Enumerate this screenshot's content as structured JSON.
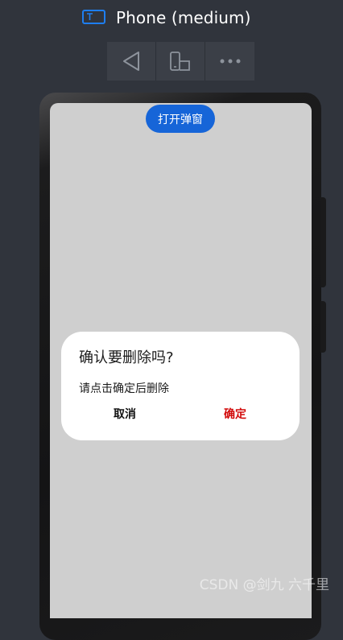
{
  "header": {
    "icon": "text-device-icon",
    "title": "Phone (medium)"
  },
  "toolbar": {
    "items": [
      {
        "icon": "back-triangle-icon"
      },
      {
        "icon": "device-rotate-icon"
      },
      {
        "icon": "more-dots-icon"
      }
    ]
  },
  "screen": {
    "open_button_label": "打开弹窗",
    "background_color": "#cfcfcf"
  },
  "dialog": {
    "title": "确认要删除吗?",
    "message": "请点击确定后删除",
    "cancel_label": "取消",
    "confirm_label": "确定",
    "confirm_color": "#d20a0a"
  },
  "watermark": {
    "text": "CSDN @剑九 六千里"
  },
  "colors": {
    "app_background": "#30343c",
    "accent_blue": "#1665d8"
  }
}
